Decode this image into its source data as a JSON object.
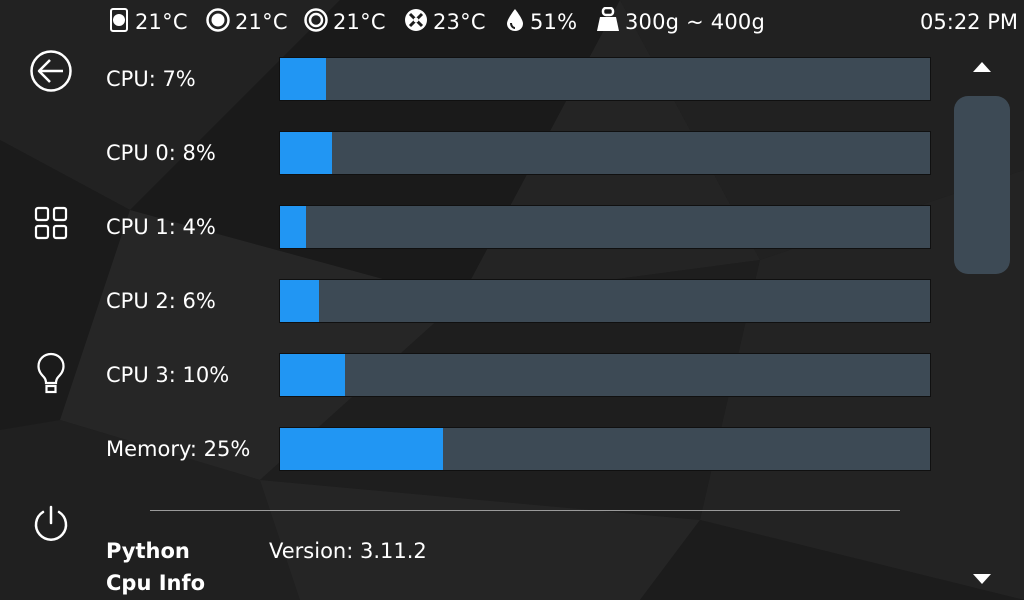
{
  "status_bar": {
    "extruder_temp": "21°C",
    "bed_temp": "21°C",
    "chamber_temp": "21°C",
    "fan_temp": "23°C",
    "humidity": "51%",
    "weight": "300g ~ 400g",
    "time": "05:22 PM",
    "icons": [
      "extruder-icon",
      "bed-icon",
      "chamber-icon",
      "fan-icon",
      "humidity-icon",
      "weight-icon"
    ]
  },
  "nav": {
    "items": [
      {
        "name": "back",
        "icon": "back-arrow-icon"
      },
      {
        "name": "menu",
        "icon": "grid-icon"
      },
      {
        "name": "light",
        "icon": "lightbulb-icon"
      },
      {
        "name": "power",
        "icon": "power-icon"
      }
    ]
  },
  "usage": {
    "rows": [
      {
        "label": "CPU: 7%",
        "value": 0.07
      },
      {
        "label": "CPU 0: 8%",
        "value": 0.08
      },
      {
        "label": "CPU 1: 4%",
        "value": 0.04
      },
      {
        "label": "CPU 2: 6%",
        "value": 0.06
      },
      {
        "label": "CPU 3: 10%",
        "value": 0.1
      },
      {
        "label": "Memory: 25%",
        "value": 0.25
      }
    ]
  },
  "info": {
    "python_label": "Python",
    "python_version": "Version: 3.11.2",
    "cpu_info_label": "Cpu Info"
  },
  "colors": {
    "bar_fill": "#2196f3",
    "bar_track": "#3d4a55",
    "background": "#1c1c1c"
  },
  "scrollbar": {
    "up_icon": "triangle-up-icon",
    "down_icon": "triangle-down-icon"
  }
}
